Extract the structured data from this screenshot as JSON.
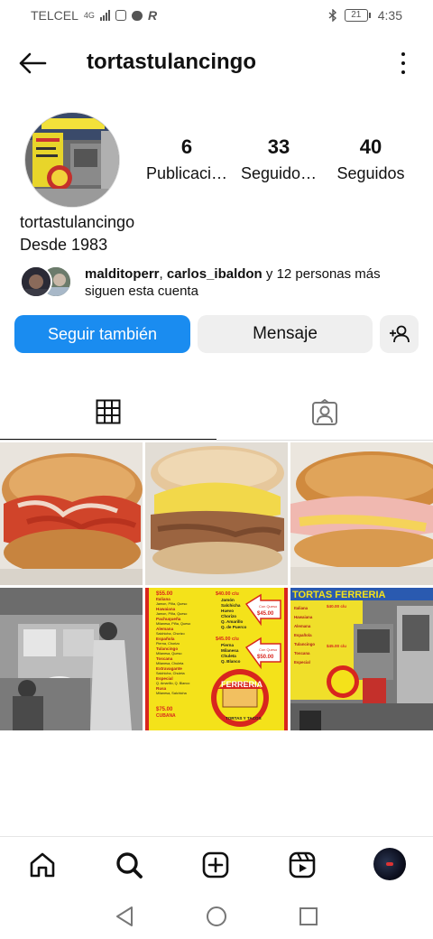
{
  "status_bar": {
    "carrier": "TELCEL",
    "network": "4G",
    "battery": "21",
    "time": "4:35"
  },
  "header": {
    "title": "tortastulancingo"
  },
  "profile": {
    "stats": [
      {
        "value": "6",
        "label": "Publicaci…"
      },
      {
        "value": "33",
        "label": "Seguido…"
      },
      {
        "value": "40",
        "label": "Seguidos"
      }
    ],
    "name": "tortastulancingo",
    "bio": "Desde 1983",
    "followed_by": {
      "user1": "malditoperr",
      "separator": ", ",
      "user2": "carlos_ibaldon",
      "rest_line1": " y 12 personas más",
      "rest_line2": "siguen esta cuenta"
    }
  },
  "actions": {
    "follow_back": "Seguir también",
    "message": "Mensaje"
  },
  "tabs": [
    {
      "icon": "grid-icon",
      "active": true
    },
    {
      "icon": "tagged-person-icon",
      "active": false
    }
  ],
  "posts": [
    {
      "kind": "photo",
      "description_icon": "torta-photo"
    },
    {
      "kind": "photo",
      "description_icon": "torta-photo"
    },
    {
      "kind": "photo",
      "description_icon": "torta-photo"
    },
    {
      "kind": "photo",
      "description_icon": "vintage-photo"
    },
    {
      "kind": "menu",
      "description_icon": "menu-image",
      "menu_lines": [
        "$55.00",
        "Italiana",
        "Hawaiana",
        "Pachuqueña",
        "Alemana",
        "Española",
        "Tulancingo",
        "Toscana",
        "Extravagante",
        "Especial",
        "Rusa",
        "$75.00",
        "CUBANA"
      ],
      "menu_right": [
        "$40.00 c/u",
        "Jamón",
        "Salchicha",
        "Huevo",
        "Chorizo",
        "Q. Amarillo",
        "Q. de Puerco",
        "$45.00 c/u",
        "Pierna",
        "Milanesa",
        "Chuleta",
        "Q. Blanco"
      ],
      "con_queso_1": "Con Queso",
      "price_1": "$45.00",
      "con_queso_2": "Con Queso",
      "price_2": "$50.00",
      "logo_text": "FERRERIA",
      "logo_sub": "TORTAS Y TACOS"
    },
    {
      "kind": "photo",
      "description_icon": "stand-photo",
      "banner": "TORTAS FERRERIA"
    }
  ],
  "colors": {
    "accent": "#1a8cf0",
    "button_gray": "#efefef",
    "menu_yellow": "#f4e21a",
    "menu_red": "#d8261e"
  },
  "bottom_nav": [
    {
      "icon": "home-icon"
    },
    {
      "icon": "search-icon"
    },
    {
      "icon": "create-post-icon"
    },
    {
      "icon": "reels-icon"
    },
    {
      "icon": "profile-avatar-icon"
    }
  ],
  "system_nav": [
    {
      "icon": "back-triangle-icon"
    },
    {
      "icon": "home-circle-icon"
    },
    {
      "icon": "recents-square-icon"
    }
  ]
}
